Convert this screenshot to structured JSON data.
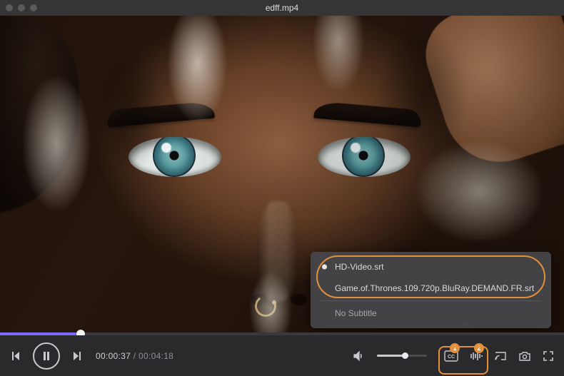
{
  "titlebar": {
    "title": "edff.mp4"
  },
  "playback": {
    "current_time": "00:00:37",
    "total_time": "00:04:18",
    "progress_percent": 14.3,
    "volume_percent": 55,
    "playing": false
  },
  "subtitles": {
    "items": [
      {
        "label": "HD-Video.srt",
        "selected": true
      },
      {
        "label": "Game.of.Thrones.109.720p.BluRay.DEMAND.FR.srt",
        "selected": false
      }
    ],
    "no_subtitle_label": "No Subtitle"
  },
  "badges": {
    "cc": "1",
    "eq": "2"
  },
  "colors": {
    "accent": "#7b6cff",
    "highlight": "#e48f3a"
  }
}
